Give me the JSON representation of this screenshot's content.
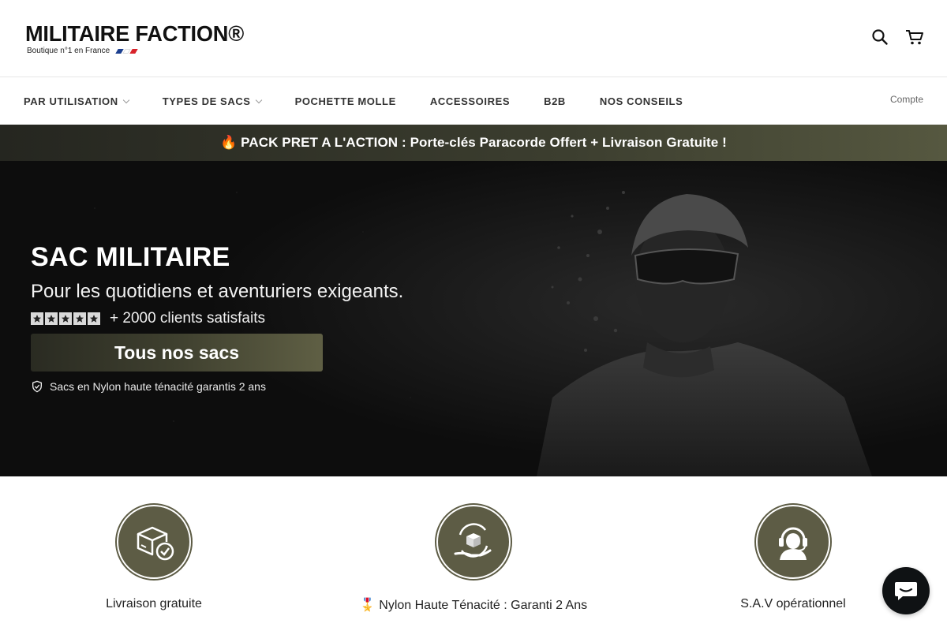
{
  "header": {
    "logo_title": "MILITAIRE FACTION®",
    "logo_subtitle": "Boutique n°1 en France",
    "flag_colors": [
      "#1b3f8f",
      "#ffffff",
      "#d8232a"
    ],
    "icons": [
      "search-icon",
      "cart-icon"
    ]
  },
  "nav": {
    "items": [
      {
        "label": "PAR UTILISATION",
        "dropdown": true
      },
      {
        "label": "TYPES DE SACS",
        "dropdown": true
      },
      {
        "label": "POCHETTE MOLLE",
        "dropdown": false
      },
      {
        "label": "ACCESSOIRES",
        "dropdown": false
      },
      {
        "label": "B2B",
        "dropdown": false
      },
      {
        "label": "NOS CONSEILS",
        "dropdown": false
      }
    ],
    "account_label": "Compte"
  },
  "announcement": {
    "text": "🔥 PACK PRET A L'ACTION : Porte-clés Paracorde Offert + Livraison Gratuite !"
  },
  "hero": {
    "title": "SAC MILITAIRE",
    "subtitle": "Pour les quotidiens et aventuriers exigeants.",
    "rating_stars": 5,
    "rating_text": "+ 2000 clients satisfaits",
    "cta_label": "Tous nos sacs",
    "guarantee_text": "Sacs en Nylon haute ténacité garantis 2 ans"
  },
  "features": [
    {
      "icon": "package-check-icon",
      "label": "Livraison gratuite"
    },
    {
      "icon": "hand-box-icon",
      "label": "🎖️ Nylon Haute Ténacité : Garanti 2 Ans"
    },
    {
      "icon": "support-agent-icon",
      "label": "S.A.V opérationnel"
    }
  ],
  "colors": {
    "accent_olive": "#5d5c45",
    "announce_dark": "#252620",
    "hero_bg": "#0d0d0d",
    "chat_bg": "#0f1214"
  }
}
